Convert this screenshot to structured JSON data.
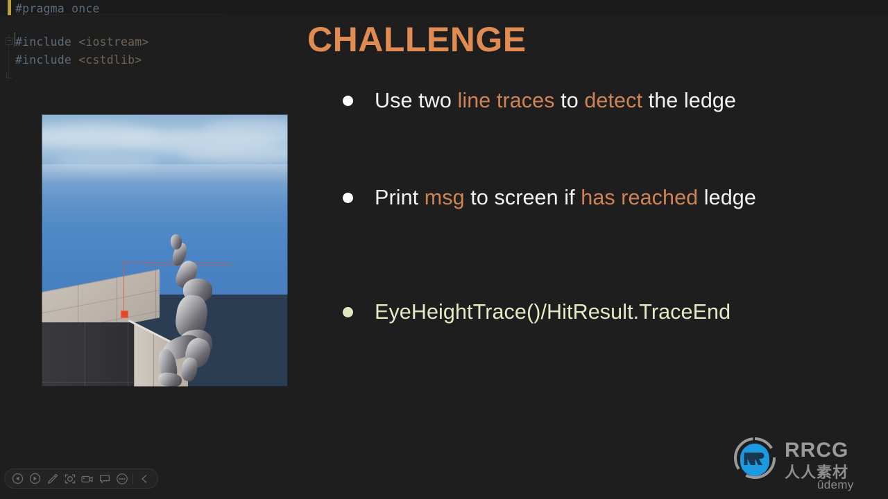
{
  "slide": {
    "title": "CHALLENGE",
    "title_color": "#e08b52",
    "background_color": "#1e1e1e",
    "bullets": [
      {
        "dot_color": "#fdfdfa",
        "segments": [
          {
            "text": "Use two ",
            "highlight": false
          },
          {
            "text": "line traces",
            "highlight": true
          },
          {
            "text": " to ",
            "highlight": false
          },
          {
            "text": "detect",
            "highlight": true
          },
          {
            "text": " the ledge",
            "highlight": false
          }
        ]
      },
      {
        "dot_color": "#fdfdfa",
        "segments": [
          {
            "text": "Print ",
            "highlight": false
          },
          {
            "text": "msg",
            "highlight": true
          },
          {
            "text": " to screen if ",
            "highlight": false
          },
          {
            "text": "has reached",
            "highlight": true
          },
          {
            "text": " ledge",
            "highlight": false
          }
        ]
      },
      {
        "dot_color": "#e4e7bd",
        "segments": [
          {
            "text": "EyeHeightTrace()/HitResult.TraceEnd",
            "highlight": false
          }
        ]
      }
    ]
  },
  "code_editor": {
    "lines": [
      {
        "tokens": [
          {
            "text": "#pragma",
            "kind": "preprocessor"
          },
          {
            "text": " once",
            "kind": "keyword"
          }
        ]
      },
      {
        "tokens": [
          {
            "text": "#include",
            "kind": "preprocessor"
          },
          {
            "text": " <iostream>",
            "kind": "header"
          }
        ]
      },
      {
        "tokens": [
          {
            "text": "#include",
            "kind": "preprocessor"
          },
          {
            "text": " <cstdlib>",
            "kind": "header"
          }
        ]
      }
    ],
    "marker_color": "#bb9e3f"
  },
  "viewport_image": {
    "caption": "Unreal Engine mannequin hanging on a building ledge with red debug line traces",
    "trace_color": "#d75b4a"
  },
  "toolbar": {
    "items": [
      {
        "label": "Previous",
        "icon": "previous-icon"
      },
      {
        "label": "Next",
        "icon": "next-icon"
      },
      {
        "label": "Pen",
        "icon": "pen-icon"
      },
      {
        "label": "Spotlight",
        "icon": "spotlight-icon"
      },
      {
        "label": "Camera",
        "icon": "camera-icon"
      },
      {
        "label": "Comment",
        "icon": "comment-icon"
      },
      {
        "label": "More options",
        "icon": "more-icon"
      },
      {
        "label": "Collapse",
        "icon": "chevron-left-icon"
      }
    ]
  },
  "watermark": {
    "brand": "RRCG",
    "subtitle": "人人素材",
    "platform": "ûdemy"
  }
}
